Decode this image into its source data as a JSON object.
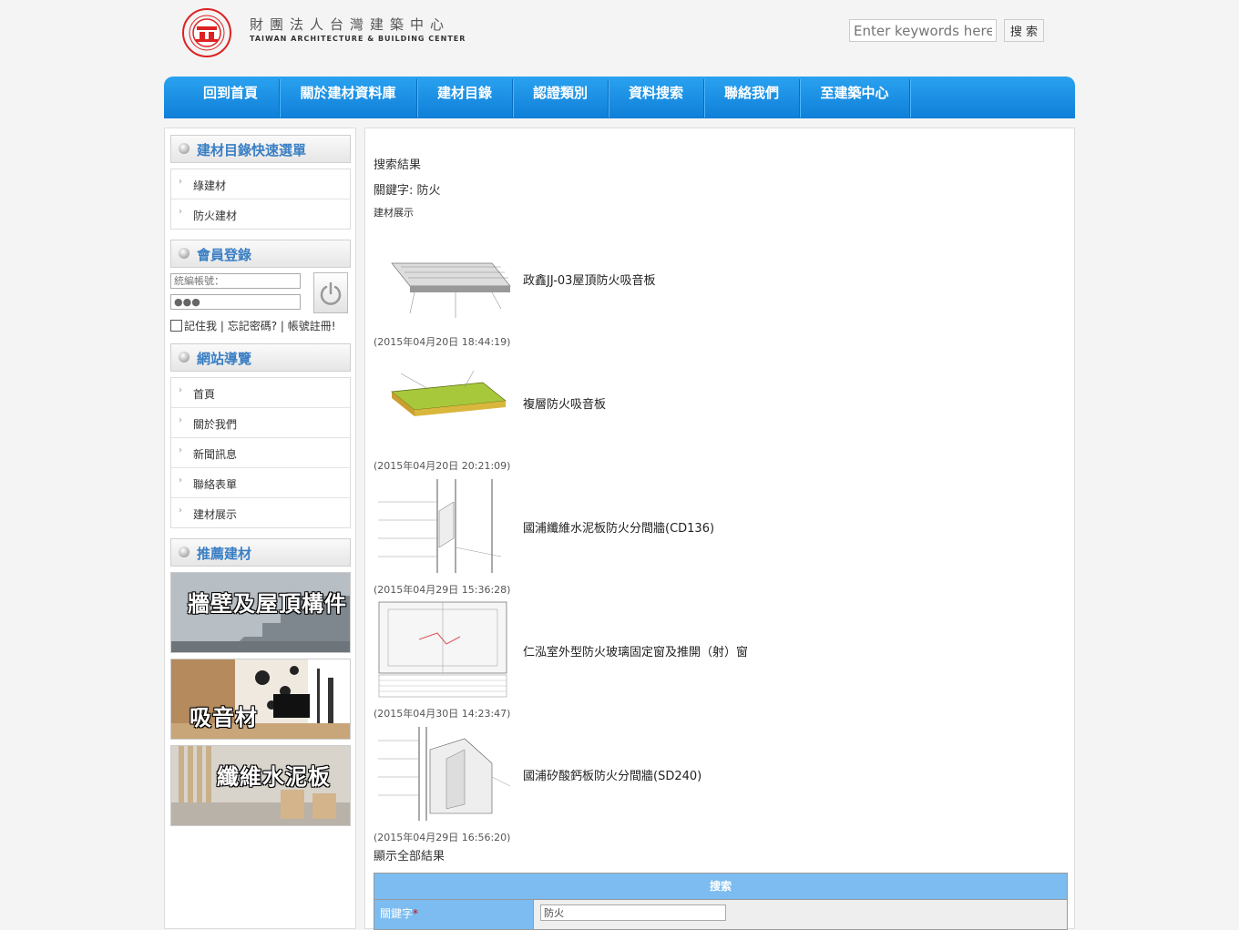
{
  "header": {
    "org_name_cn": "財團法人台灣建築中心",
    "org_name_en": "TAIWAN ARCHITECTURE & BUILDING CENTER",
    "search_placeholder": "Enter keywords here!",
    "search_button": "搜 索"
  },
  "nav": {
    "items": [
      "回到首頁",
      "關於建材資料庫",
      "建材目錄",
      "認證類別",
      "資料搜索",
      "聯絡我們",
      "至建築中心"
    ]
  },
  "sidebar": {
    "quick_menu": {
      "title": "建材目錄快速選單",
      "items": [
        "綠建材",
        "防火建材"
      ]
    },
    "login": {
      "title": "會員登錄",
      "account_placeholder": "統編帳號：",
      "password_value": "●●●",
      "remember": "記住我",
      "forgot": "忘記密碼?",
      "register": "帳號註冊!",
      "sep": "|"
    },
    "site_nav": {
      "title": "網站導覽",
      "items": [
        "首頁",
        "關於我們",
        "新聞訊息",
        "聯絡表單",
        "建材展示"
      ]
    },
    "recommend": {
      "title": "推薦建材",
      "banners": [
        "牆壁及屋頂構件",
        "吸音材",
        "纖維水泥板"
      ]
    }
  },
  "main": {
    "title": "搜索結果",
    "keyword_line": "關鍵字: 防火",
    "section_label": "建材展示",
    "results": [
      {
        "name": "政鑫JJ-03屋頂防火吸音板",
        "date": "(2015年04月20日 18:44:19)"
      },
      {
        "name": "複層防火吸音板",
        "date": "(2015年04月20日 20:21:09)"
      },
      {
        "name": "國浦纖維水泥板防火分間牆(CD136)",
        "date": "(2015年04月29日 15:36:28)"
      },
      {
        "name": "仁泓室外型防火玻璃固定窗及推開（射）窗",
        "date": "(2015年04月30日 14:23:47)"
      },
      {
        "name": "國浦矽酸鈣板防火分間牆(SD240)",
        "date": "(2015年04月29日 16:56:20)"
      }
    ],
    "show_all": "顯示全部結果",
    "search_form": {
      "header": "搜索",
      "keyword_label": "關鍵字",
      "required_mark": "*",
      "keyword_value": "防火"
    }
  }
}
